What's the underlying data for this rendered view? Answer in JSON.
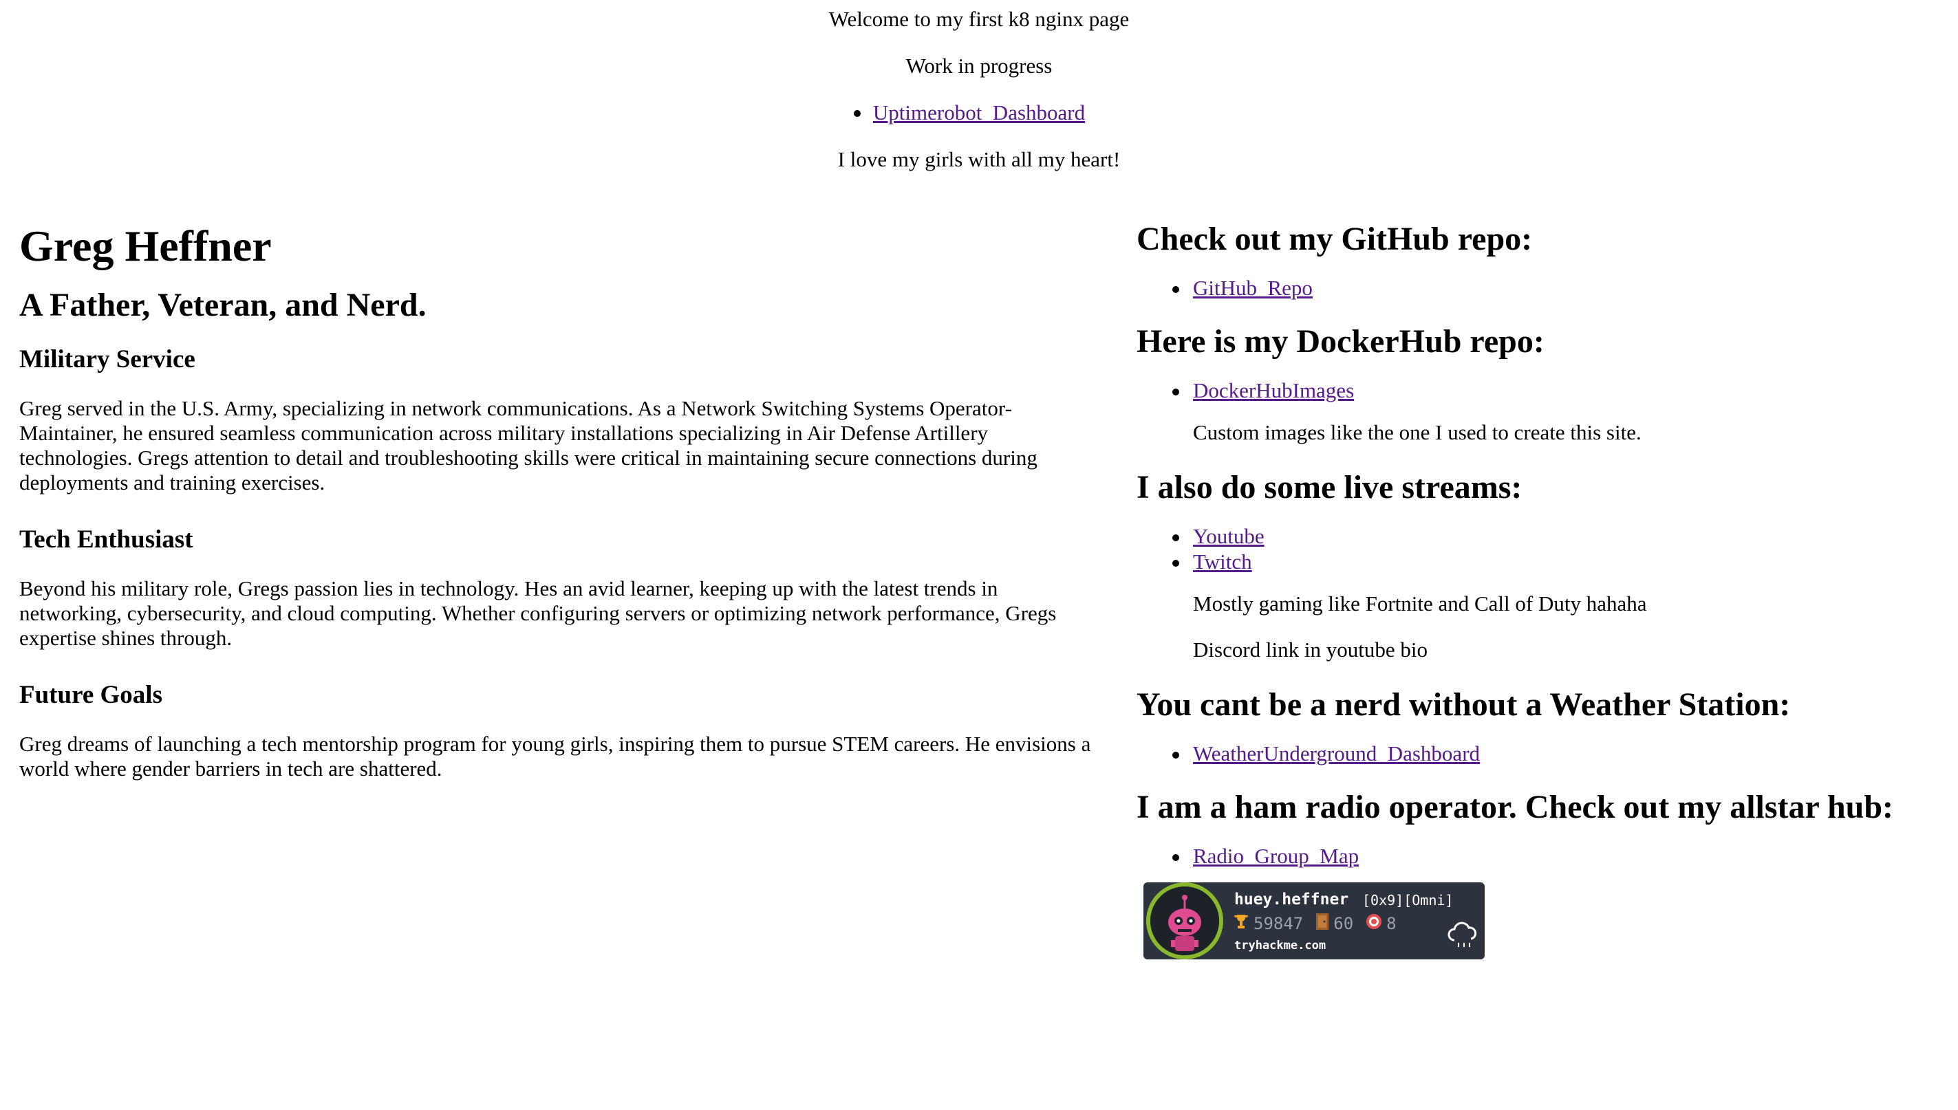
{
  "top": {
    "welcome": "Welcome to my first k8 nginx page",
    "progress": "Work in progress",
    "dashboard_link": "Uptimerobot_Dashboard",
    "love": "I love my girls with all my heart!"
  },
  "profile": {
    "name": "Greg Heffner",
    "tagline": "A Father, Veteran, and Nerd.",
    "sections": [
      {
        "heading": "Military Service",
        "text": "Greg served in the U.S. Army, specializing in network communications. As a Network Switching Systems Operator-Maintainer, he ensured seamless communication across military installations specializing in Air Defense Artillery technologies. Gregs attention to detail and troubleshooting skills were critical in maintaining secure connections during deployments and training exercises."
      },
      {
        "heading": "Tech Enthusiast",
        "text": "Beyond his military role, Gregs passion lies in technology. Hes an avid learner, keeping up with the latest trends in networking, cybersecurity, and cloud computing. Whether configuring servers or optimizing network performance, Gregs expertise shines through."
      },
      {
        "heading": "Future Goals",
        "text": "Greg dreams of launching a tech mentorship program for young girls, inspiring them to pursue STEM careers. He envisions a world where gender barriers in tech are shattered."
      }
    ]
  },
  "links": {
    "github_heading": "Check out my GitHub repo:",
    "github_link": "GitHub_Repo",
    "dockerhub_heading": "Here is my DockerHub repo:",
    "dockerhub_link": "DockerHubImages",
    "dockerhub_note": "Custom images like the one I used to create this site.",
    "streams_heading": "I also do some live streams:",
    "youtube_link": "Youtube",
    "twitch_link": "Twitch",
    "streams_note1": "Mostly gaming like Fortnite and Call of Duty hahaha",
    "streams_note2": "Discord link in youtube bio",
    "weather_heading": "You cant be a nerd without a Weather Station:",
    "weather_link": "WeatherUnderground_Dashboard",
    "ham_heading": "I am a ham radio operator. Check out my allstar hub:",
    "ham_link": "Radio_Group_Map"
  },
  "badge": {
    "username": "huey.heffner",
    "rank": "[0x9][Omni]",
    "points": "59847",
    "rooms": "60",
    "badges": "8",
    "site": "tryhackme.com",
    "icons": [
      "trophy-icon",
      "door-icon",
      "target-icon",
      "cloud-icon"
    ]
  },
  "colors": {
    "link_visited": "#551a8b",
    "link_fresh": "#0000ee",
    "badge_bg": "#2c323e",
    "badge_ring": "#88b82b"
  }
}
